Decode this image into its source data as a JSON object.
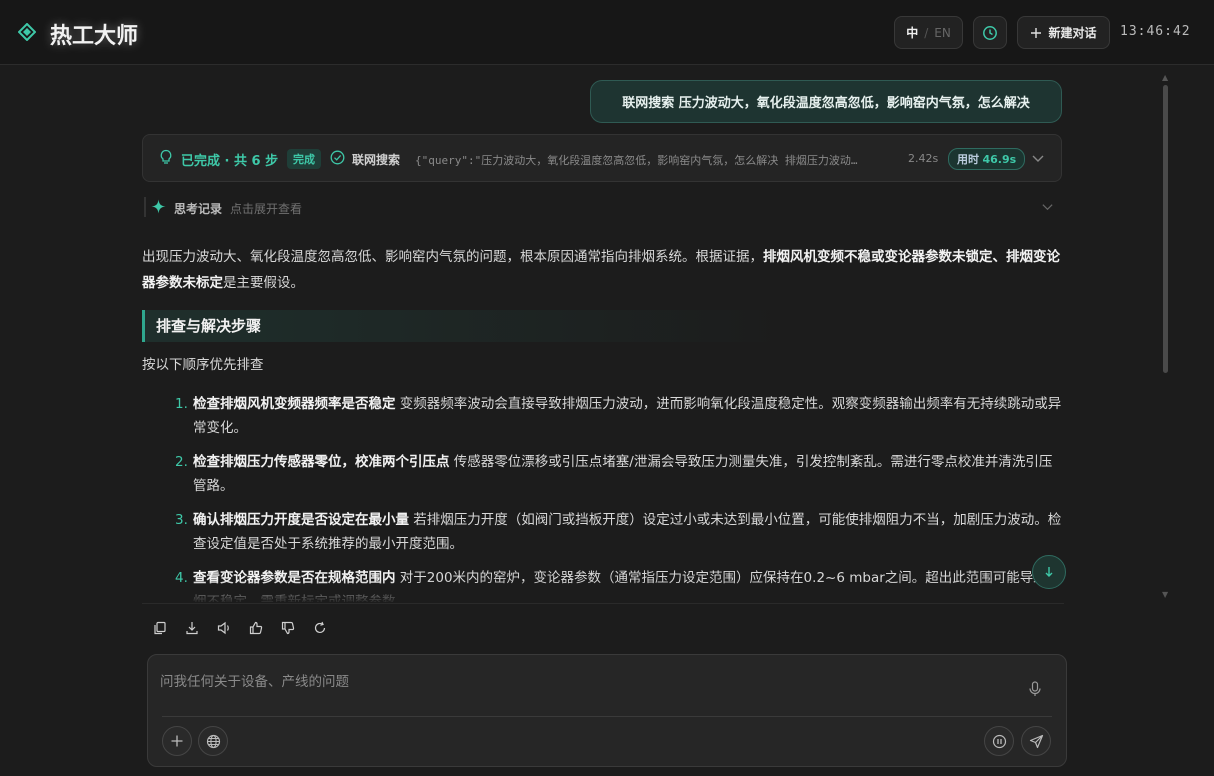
{
  "header": {
    "app_title": "热工大师",
    "lang_zh": "中",
    "lang_sep": "/",
    "lang_en": "EN",
    "new_chat_label": "新建对话",
    "clock": "13:46:42",
    "accent_color": "#3ec8a8"
  },
  "user_message": "联网搜索 压力波动大，氧化段温度忽高忽低，影响窑内气氛，怎么解决",
  "status": {
    "summary": "已完成 · 共 6 步",
    "badge": "完成",
    "step_label": "联网搜索",
    "query": "{\"query\":\"压力波动大，氧化段温度忽高忽低，影响窑内气氛，怎么解决 排烟压力波动…",
    "duration": "2.42s",
    "elapsed_label": "用时",
    "elapsed_value": "46.9s"
  },
  "thinking": {
    "title": "思考记录",
    "hint": "点击展开查看"
  },
  "answer": {
    "intro_plain": "出现压力波动大、氧化段温度忽高忽低、影响窑内气氛的问题，根本原因通常指向排烟系统。根据证据，",
    "intro_bold": "排烟风机变频不稳或变论器参数未锁定、排烟变论器参数未标定",
    "intro_tail": "是主要假设。",
    "section_title": "排查与解决步骤",
    "section_intro": "按以下顺序优先排查",
    "steps": [
      {
        "num": "1.",
        "bold": "检查排烟风机变频器频率是否稳定",
        "text": " 变频器频率波动会直接导致排烟压力波动，进而影响氧化段温度稳定性。观察变频器输出频率有无持续跳动或异常变化。"
      },
      {
        "num": "2.",
        "bold": "检查排烟压力传感器零位，校准两个引压点",
        "text": " 传感器零位漂移或引压点堵塞/泄漏会导致压力测量失准，引发控制紊乱。需进行零点校准并清洗引压管路。"
      },
      {
        "num": "3.",
        "bold": "确认排烟压力开度是否设定在最小量",
        "text": " 若排烟压力开度（如阀门或挡板开度）设定过小或未达到最小位置，可能使排烟阻力不当，加剧压力波动。检查设定值是否处于系统推荐的最小开度范围。"
      },
      {
        "num": "4.",
        "bold": "查看变论器参数是否在规格范围内",
        "text": " 对于200米内的窑炉，变论器参数（通常指压力设定范围）应保持在0.2~6 mbar之间。超出此范围可能导致排烟不稳定，需重新标定或调整参数。"
      }
    ]
  },
  "composer": {
    "placeholder": "问我任何关于设备、产线的问题"
  }
}
